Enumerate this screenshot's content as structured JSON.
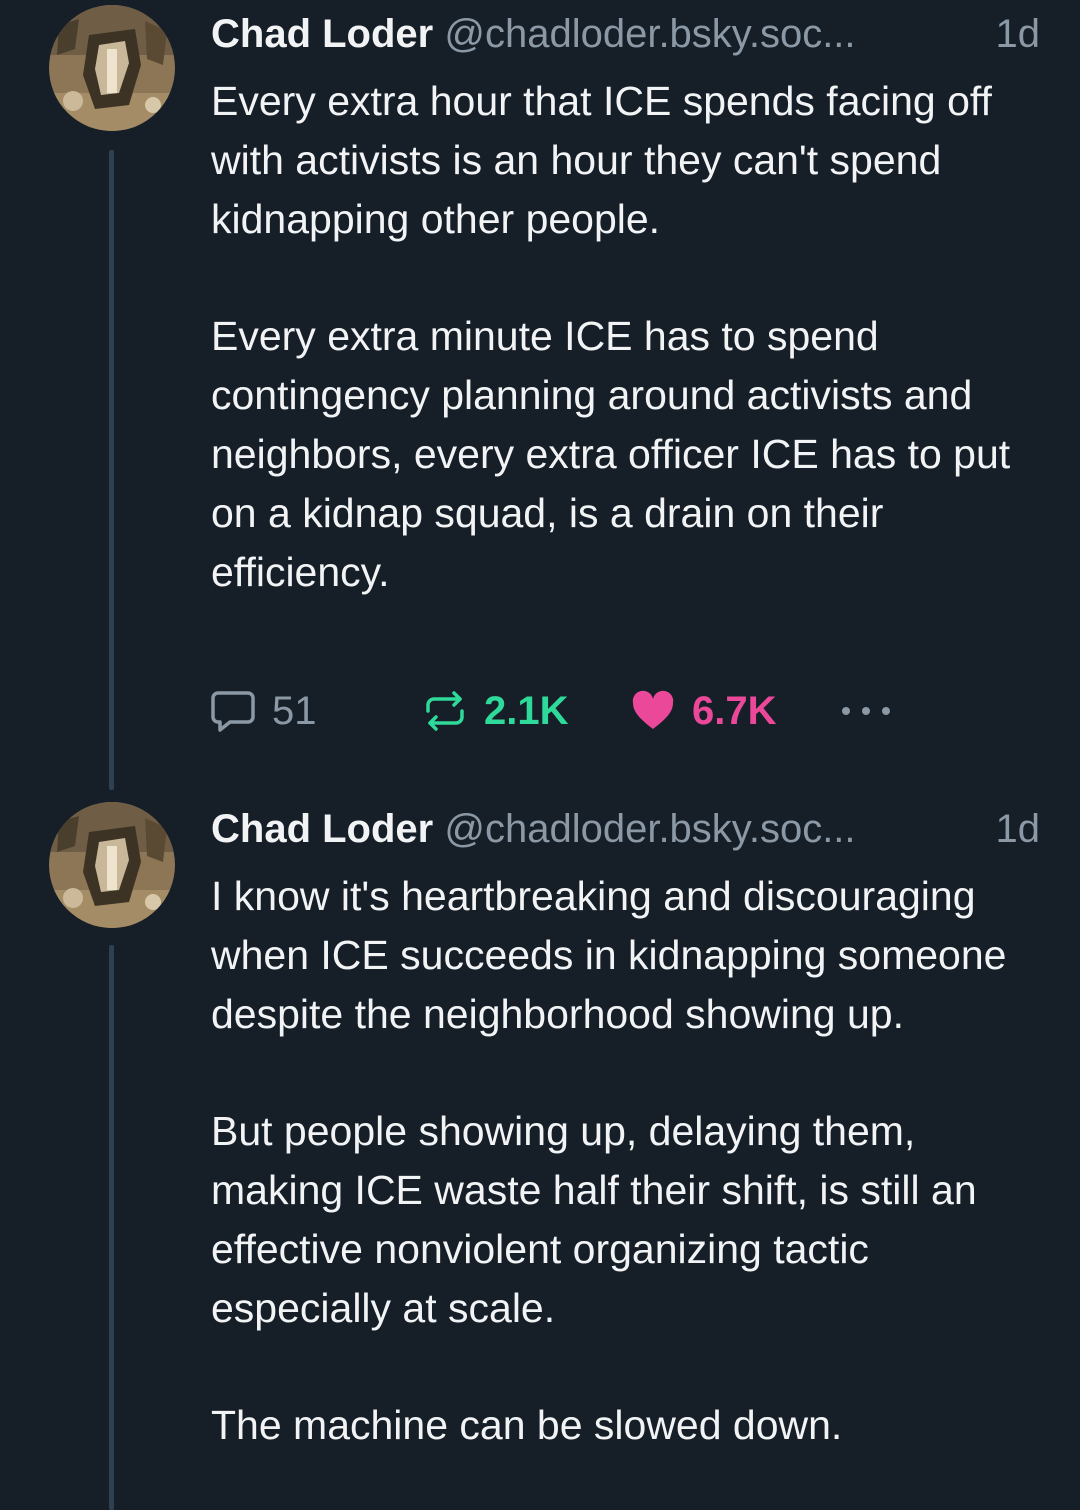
{
  "posts": [
    {
      "author": {
        "display_name": "Chad Loder",
        "handle": "@chadloder.bsky.soc...",
        "avatar": "avatar-photo"
      },
      "timestamp": "1d",
      "paragraphs": [
        "Every extra hour that ICE spends facing off with activists is an hour they can't spend kidnapping other people.",
        "Every extra minute ICE has to spend contingency planning around activists and neighbors, every extra officer ICE has to put on a kidnap squad, is a drain on their efficiency."
      ],
      "stats": {
        "replies": "51",
        "reposts": "2.1K",
        "likes": "6.7K"
      },
      "icons": {
        "reply": "speech-bubble-icon",
        "repost": "repost-arrows-icon",
        "like": "heart-icon",
        "more": "ellipsis-icon"
      }
    },
    {
      "author": {
        "display_name": "Chad Loder",
        "handle": "@chadloder.bsky.soc...",
        "avatar": "avatar-photo"
      },
      "timestamp": "1d",
      "paragraphs": [
        "I know it's heartbreaking and discouraging when ICE succeeds in kidnapping someone despite the neighborhood showing up.",
        "But people showing up, delaying them, making ICE waste half their shift, is still an effective nonviolent organizing tactic especially at scale.",
        "The machine can be slowed down."
      ]
    }
  ],
  "colors": {
    "background": "#161e27",
    "text": "#f1f3f5",
    "muted": "#8b98a6",
    "thread_line": "#2e4052",
    "repost_active": "#2fd99a",
    "like_active": "#ec4899"
  }
}
